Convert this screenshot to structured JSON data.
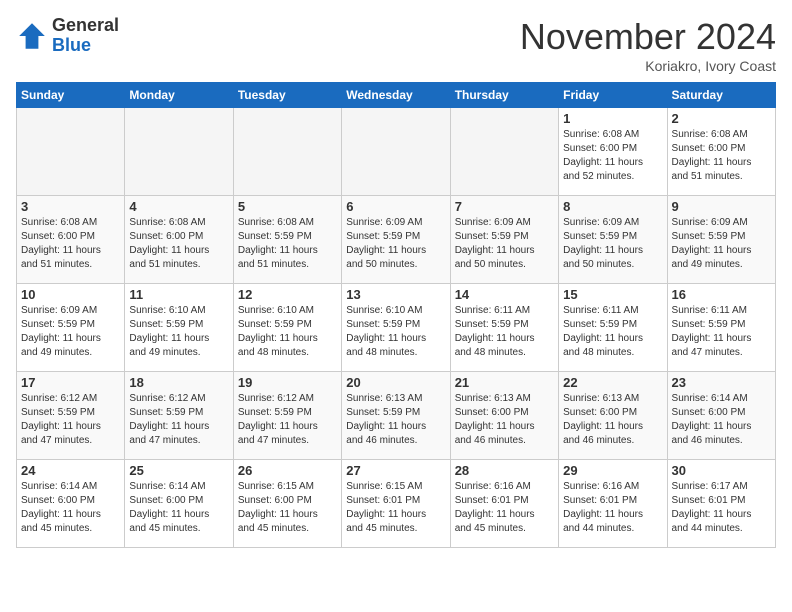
{
  "header": {
    "logo_general": "General",
    "logo_blue": "Blue",
    "month_title": "November 2024",
    "location": "Koriakro, Ivory Coast"
  },
  "calendar": {
    "days_of_week": [
      "Sunday",
      "Monday",
      "Tuesday",
      "Wednesday",
      "Thursday",
      "Friday",
      "Saturday"
    ],
    "weeks": [
      {
        "days": [
          {
            "num": "",
            "info": "",
            "empty": true
          },
          {
            "num": "",
            "info": "",
            "empty": true
          },
          {
            "num": "",
            "info": "",
            "empty": true
          },
          {
            "num": "",
            "info": "",
            "empty": true
          },
          {
            "num": "",
            "info": "",
            "empty": true
          },
          {
            "num": "1",
            "info": "Sunrise: 6:08 AM\nSunset: 6:00 PM\nDaylight: 11 hours\nand 52 minutes.",
            "empty": false
          },
          {
            "num": "2",
            "info": "Sunrise: 6:08 AM\nSunset: 6:00 PM\nDaylight: 11 hours\nand 51 minutes.",
            "empty": false
          }
        ]
      },
      {
        "days": [
          {
            "num": "3",
            "info": "Sunrise: 6:08 AM\nSunset: 6:00 PM\nDaylight: 11 hours\nand 51 minutes.",
            "empty": false
          },
          {
            "num": "4",
            "info": "Sunrise: 6:08 AM\nSunset: 6:00 PM\nDaylight: 11 hours\nand 51 minutes.",
            "empty": false
          },
          {
            "num": "5",
            "info": "Sunrise: 6:08 AM\nSunset: 5:59 PM\nDaylight: 11 hours\nand 51 minutes.",
            "empty": false
          },
          {
            "num": "6",
            "info": "Sunrise: 6:09 AM\nSunset: 5:59 PM\nDaylight: 11 hours\nand 50 minutes.",
            "empty": false
          },
          {
            "num": "7",
            "info": "Sunrise: 6:09 AM\nSunset: 5:59 PM\nDaylight: 11 hours\nand 50 minutes.",
            "empty": false
          },
          {
            "num": "8",
            "info": "Sunrise: 6:09 AM\nSunset: 5:59 PM\nDaylight: 11 hours\nand 50 minutes.",
            "empty": false
          },
          {
            "num": "9",
            "info": "Sunrise: 6:09 AM\nSunset: 5:59 PM\nDaylight: 11 hours\nand 49 minutes.",
            "empty": false
          }
        ]
      },
      {
        "days": [
          {
            "num": "10",
            "info": "Sunrise: 6:09 AM\nSunset: 5:59 PM\nDaylight: 11 hours\nand 49 minutes.",
            "empty": false
          },
          {
            "num": "11",
            "info": "Sunrise: 6:10 AM\nSunset: 5:59 PM\nDaylight: 11 hours\nand 49 minutes.",
            "empty": false
          },
          {
            "num": "12",
            "info": "Sunrise: 6:10 AM\nSunset: 5:59 PM\nDaylight: 11 hours\nand 48 minutes.",
            "empty": false
          },
          {
            "num": "13",
            "info": "Sunrise: 6:10 AM\nSunset: 5:59 PM\nDaylight: 11 hours\nand 48 minutes.",
            "empty": false
          },
          {
            "num": "14",
            "info": "Sunrise: 6:11 AM\nSunset: 5:59 PM\nDaylight: 11 hours\nand 48 minutes.",
            "empty": false
          },
          {
            "num": "15",
            "info": "Sunrise: 6:11 AM\nSunset: 5:59 PM\nDaylight: 11 hours\nand 48 minutes.",
            "empty": false
          },
          {
            "num": "16",
            "info": "Sunrise: 6:11 AM\nSunset: 5:59 PM\nDaylight: 11 hours\nand 47 minutes.",
            "empty": false
          }
        ]
      },
      {
        "days": [
          {
            "num": "17",
            "info": "Sunrise: 6:12 AM\nSunset: 5:59 PM\nDaylight: 11 hours\nand 47 minutes.",
            "empty": false
          },
          {
            "num": "18",
            "info": "Sunrise: 6:12 AM\nSunset: 5:59 PM\nDaylight: 11 hours\nand 47 minutes.",
            "empty": false
          },
          {
            "num": "19",
            "info": "Sunrise: 6:12 AM\nSunset: 5:59 PM\nDaylight: 11 hours\nand 47 minutes.",
            "empty": false
          },
          {
            "num": "20",
            "info": "Sunrise: 6:13 AM\nSunset: 5:59 PM\nDaylight: 11 hours\nand 46 minutes.",
            "empty": false
          },
          {
            "num": "21",
            "info": "Sunrise: 6:13 AM\nSunset: 6:00 PM\nDaylight: 11 hours\nand 46 minutes.",
            "empty": false
          },
          {
            "num": "22",
            "info": "Sunrise: 6:13 AM\nSunset: 6:00 PM\nDaylight: 11 hours\nand 46 minutes.",
            "empty": false
          },
          {
            "num": "23",
            "info": "Sunrise: 6:14 AM\nSunset: 6:00 PM\nDaylight: 11 hours\nand 46 minutes.",
            "empty": false
          }
        ]
      },
      {
        "days": [
          {
            "num": "24",
            "info": "Sunrise: 6:14 AM\nSunset: 6:00 PM\nDaylight: 11 hours\nand 45 minutes.",
            "empty": false
          },
          {
            "num": "25",
            "info": "Sunrise: 6:14 AM\nSunset: 6:00 PM\nDaylight: 11 hours\nand 45 minutes.",
            "empty": false
          },
          {
            "num": "26",
            "info": "Sunrise: 6:15 AM\nSunset: 6:00 PM\nDaylight: 11 hours\nand 45 minutes.",
            "empty": false
          },
          {
            "num": "27",
            "info": "Sunrise: 6:15 AM\nSunset: 6:01 PM\nDaylight: 11 hours\nand 45 minutes.",
            "empty": false
          },
          {
            "num": "28",
            "info": "Sunrise: 6:16 AM\nSunset: 6:01 PM\nDaylight: 11 hours\nand 45 minutes.",
            "empty": false
          },
          {
            "num": "29",
            "info": "Sunrise: 6:16 AM\nSunset: 6:01 PM\nDaylight: 11 hours\nand 44 minutes.",
            "empty": false
          },
          {
            "num": "30",
            "info": "Sunrise: 6:17 AM\nSunset: 6:01 PM\nDaylight: 11 hours\nand 44 minutes.",
            "empty": false
          }
        ]
      }
    ]
  }
}
